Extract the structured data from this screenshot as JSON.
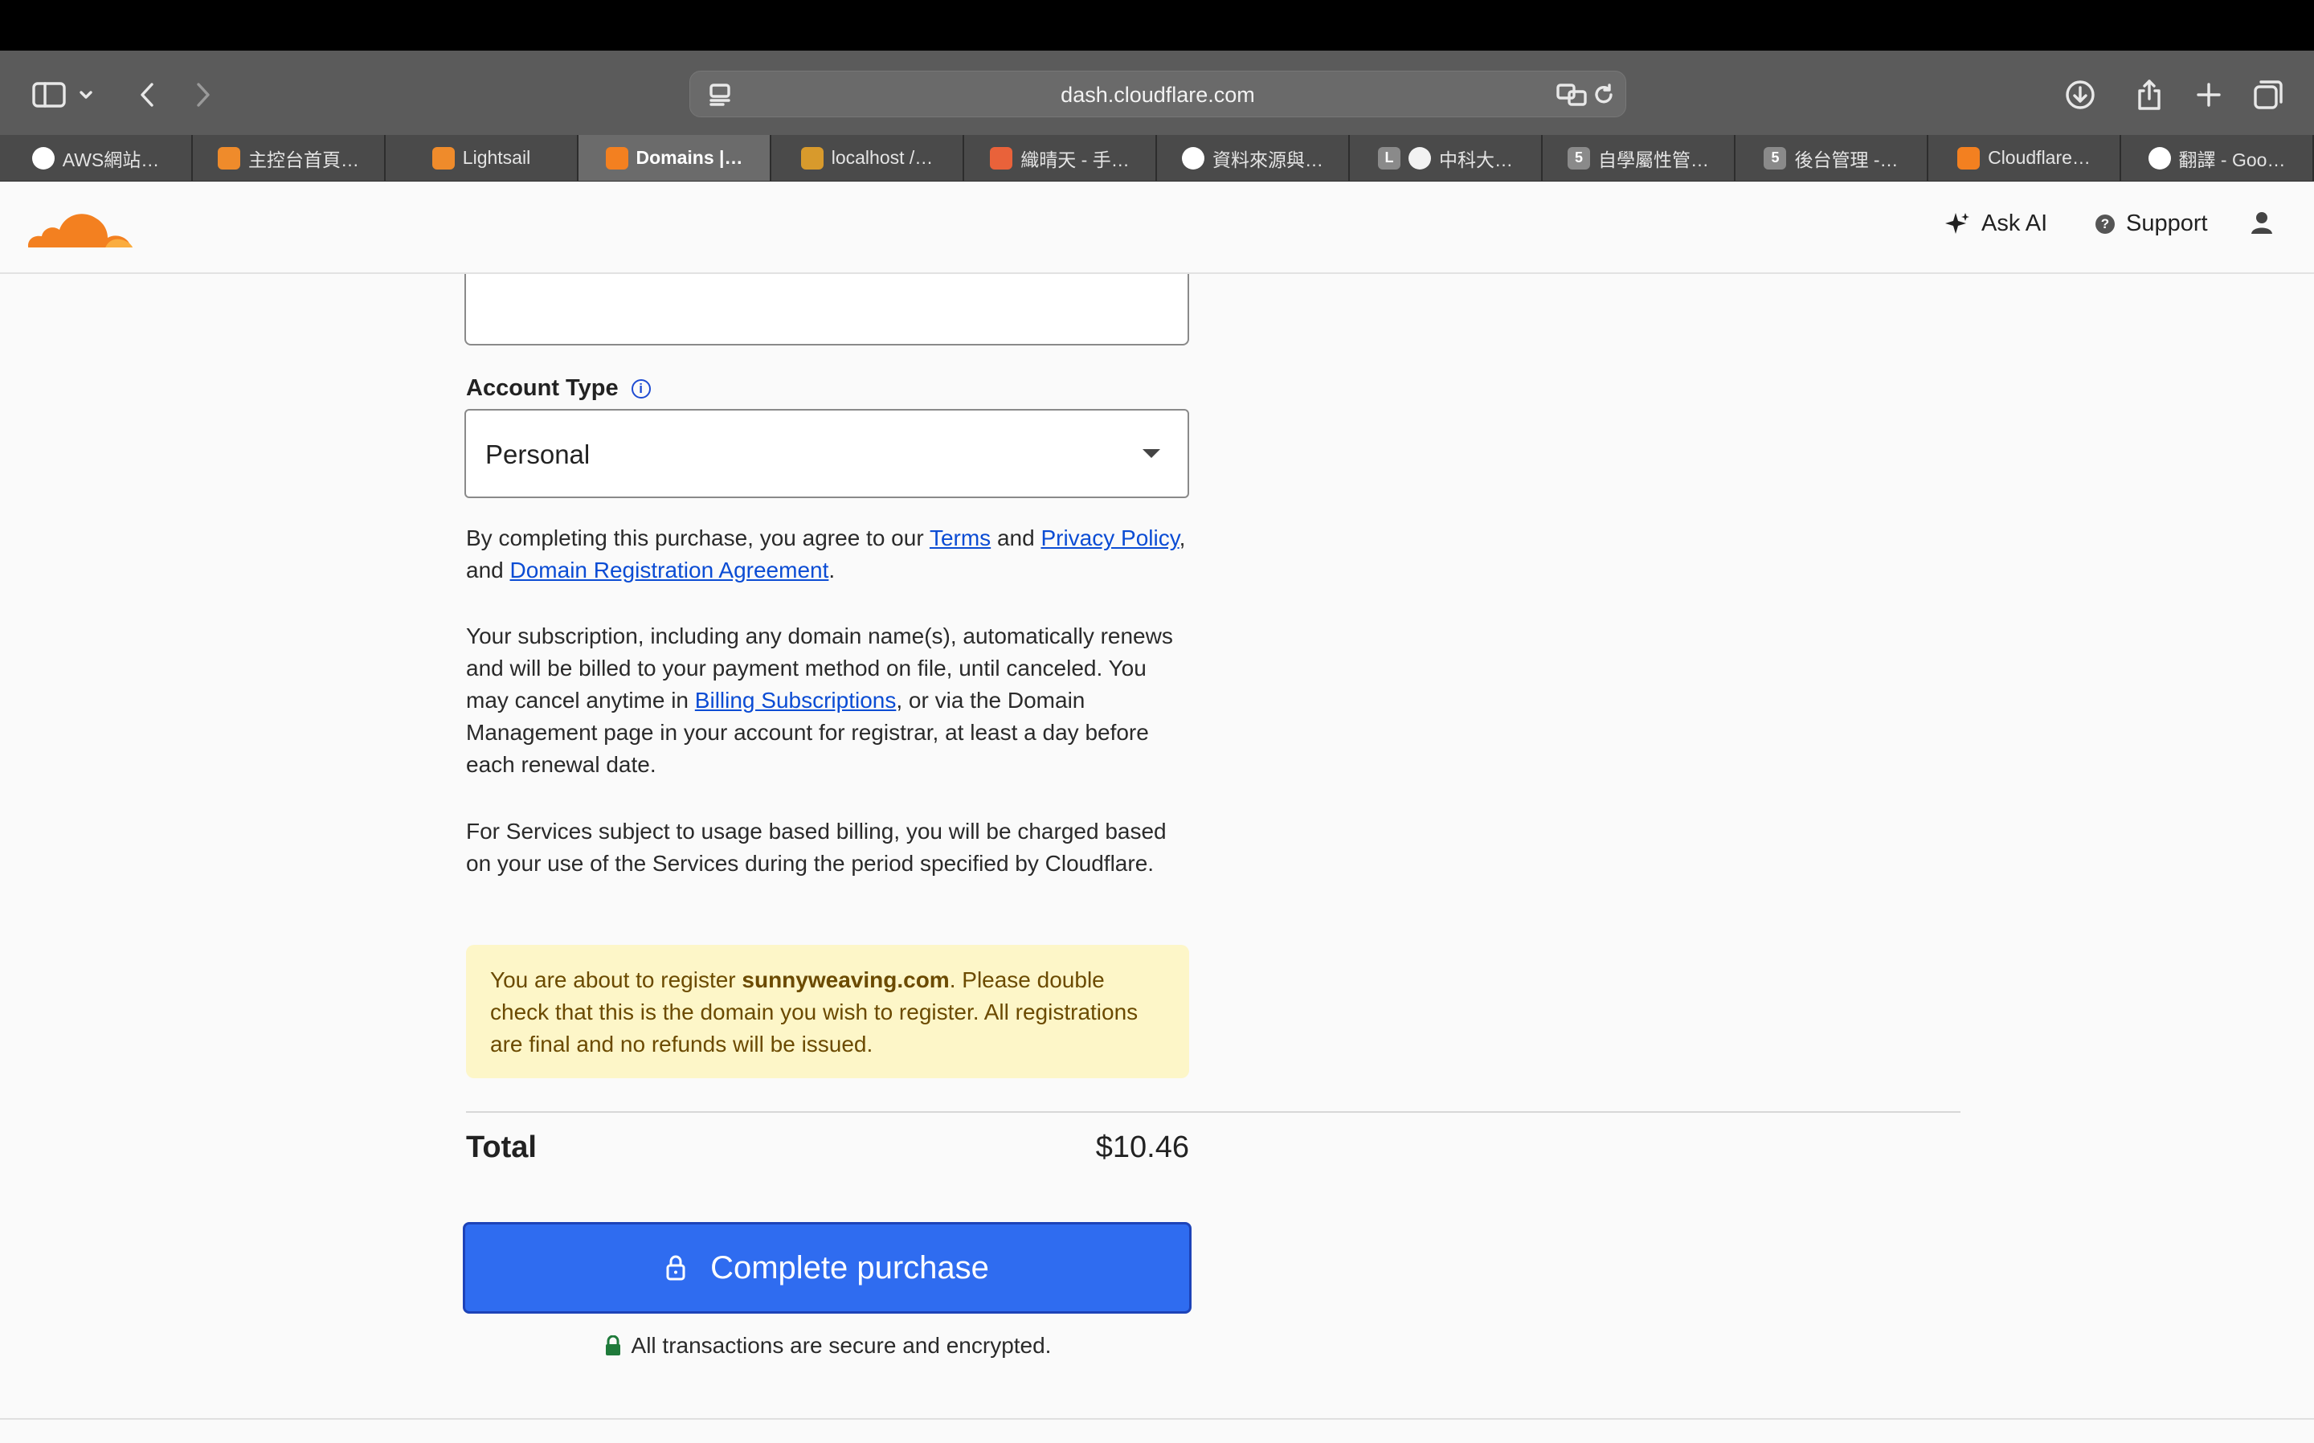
{
  "browser": {
    "url": "dash.cloudflare.com",
    "tabs": [
      {
        "label": "AWS網站…",
        "icon": "chatgpt-icon"
      },
      {
        "label": "主控台首頁…",
        "icon": "aws-box-icon"
      },
      {
        "label": "Lightsail",
        "icon": "aws-box-icon"
      },
      {
        "label": "Domains |…",
        "icon": "cloudflare-icon",
        "active": true
      },
      {
        "label": "localhost /…",
        "icon": "phpmyadmin-icon"
      },
      {
        "label": "織晴天 - 手…",
        "icon": "site-icon"
      },
      {
        "label": "資料來源與…",
        "icon": "chatgpt-icon"
      },
      {
        "label": "中科大…",
        "icon": "baseball-icon",
        "badge": "L"
      },
      {
        "label": "自學屬性管…",
        "icon": "number-icon",
        "badge": "5"
      },
      {
        "label": "後台管理 -…",
        "icon": "number-icon",
        "badge": "5"
      },
      {
        "label": "Cloudflare…",
        "icon": "cloudflare-icon"
      },
      {
        "label": "翻譯 - Goo…",
        "icon": "google-icon"
      }
    ]
  },
  "header": {
    "ask_ai": "Ask AI",
    "support": "Support"
  },
  "form": {
    "account_type_label": "Account Type",
    "account_type_value": "Personal",
    "agree_prefix": "By completing this purchase, you agree to our ",
    "terms": "Terms",
    "and": " and ",
    "privacy": "Privacy Policy",
    "comma_and": ", and ",
    "dra": "Domain Registration Agreement",
    "period": ".",
    "sub_part1": "Your subscription, including any domain name(s), automatically renews and will be billed to your payment method on file, until canceled. You may cancel anytime in ",
    "billing_link": "Billing Subscriptions",
    "sub_part2": ", or via the Domain Management page in your account for registrar, at least a day before each renewal date.",
    "usage_text": "For Services subject to usage based billing, you will be charged based on your use of the Services during the period specified by Cloudflare.",
    "notice_prefix": "You are about to register ",
    "notice_domain": "sunnyweaving.com",
    "notice_suffix": ". Please double check that this is the domain you wish to register. All registrations are final and no refunds will be issued.",
    "total_label": "Total",
    "total_value": "$10.46",
    "purchase_button": "Complete purchase",
    "secure_text": "All transactions are secure and encrypted."
  },
  "colors": {
    "primary_button": "#2f6cf0",
    "link": "#0b4cd4",
    "notice_bg": "#fdf6c8",
    "cloudflare_orange": "#f38020"
  }
}
